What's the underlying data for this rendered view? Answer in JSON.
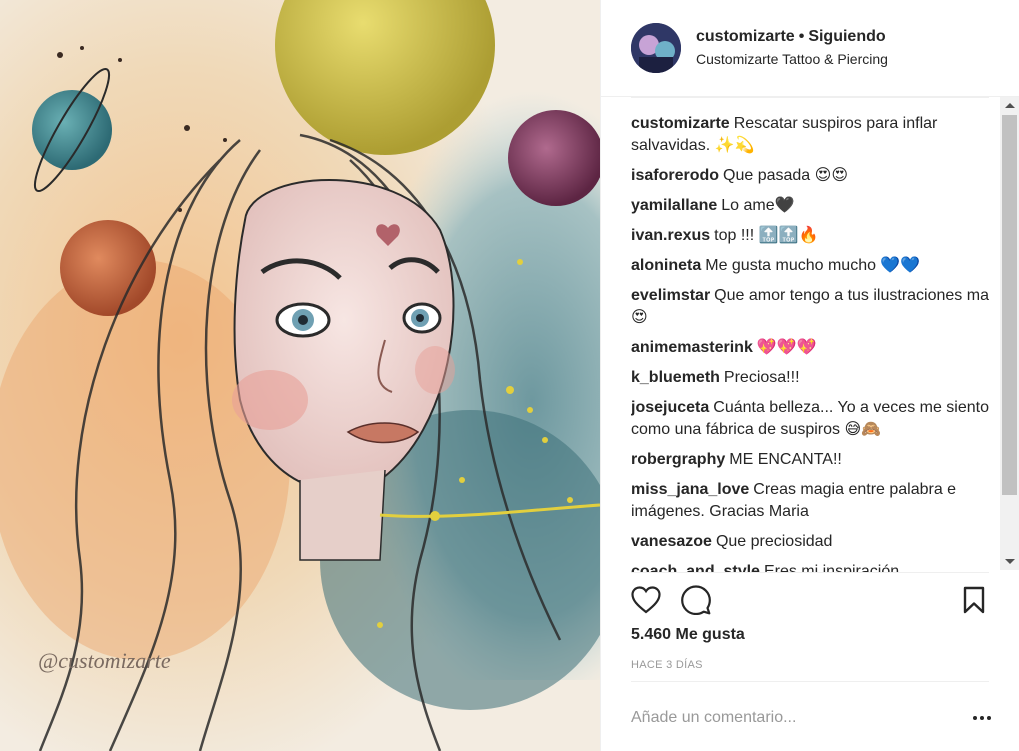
{
  "post": {
    "username": "customizarte",
    "separator": "•",
    "follow_status": "Siguiendo",
    "location": "Customizarte Tattoo & Piercing",
    "likes": "5.460 Me gusta",
    "time_ago": "HACE 3 DÍAS",
    "add_comment_placeholder": "Añade un comentario...",
    "image_signature": "@customizarte"
  },
  "comments": [
    {
      "user": "customizarte",
      "text": "Rescatar suspiros para inflar salvavidas. ✨💫"
    },
    {
      "user": "isaforerodo",
      "text": "Que pasada 😍😍"
    },
    {
      "user": "yamilallane",
      "text": "Lo ame🖤"
    },
    {
      "user": "ivan.rexus",
      "text": "top !!! 🔝🔝🔥"
    },
    {
      "user": "alonineta",
      "text": "Me gusta mucho mucho 💙💙"
    },
    {
      "user": "evelimstar",
      "text": "Que amor tengo a tus ilustraciones ma 😍"
    },
    {
      "user": "animemasterink",
      "text": "💖💖💖"
    },
    {
      "user": "k_bluemeth",
      "text": "Preciosa!!!"
    },
    {
      "user": "josejuceta",
      "text": "Cuánta belleza... Yo a veces me siento como una fábrica de suspiros 😅🙈"
    },
    {
      "user": "robergraphy",
      "text": "ME ENCANTA!!"
    },
    {
      "user": "miss_jana_love",
      "text": "Creas magia entre palabra e imágenes. Gracias Maria"
    },
    {
      "user": "vanesazoe",
      "text": "Que preciosidad"
    },
    {
      "user": "coach_and_style",
      "text": "Eres mi inspiración"
    }
  ],
  "icons": {
    "like": "heart-icon",
    "comment": "comment-bubble-icon",
    "save": "bookmark-icon",
    "more": "more-options-icon"
  },
  "colors": {
    "text": "#262626",
    "muted": "#999999",
    "border": "#efefef"
  }
}
